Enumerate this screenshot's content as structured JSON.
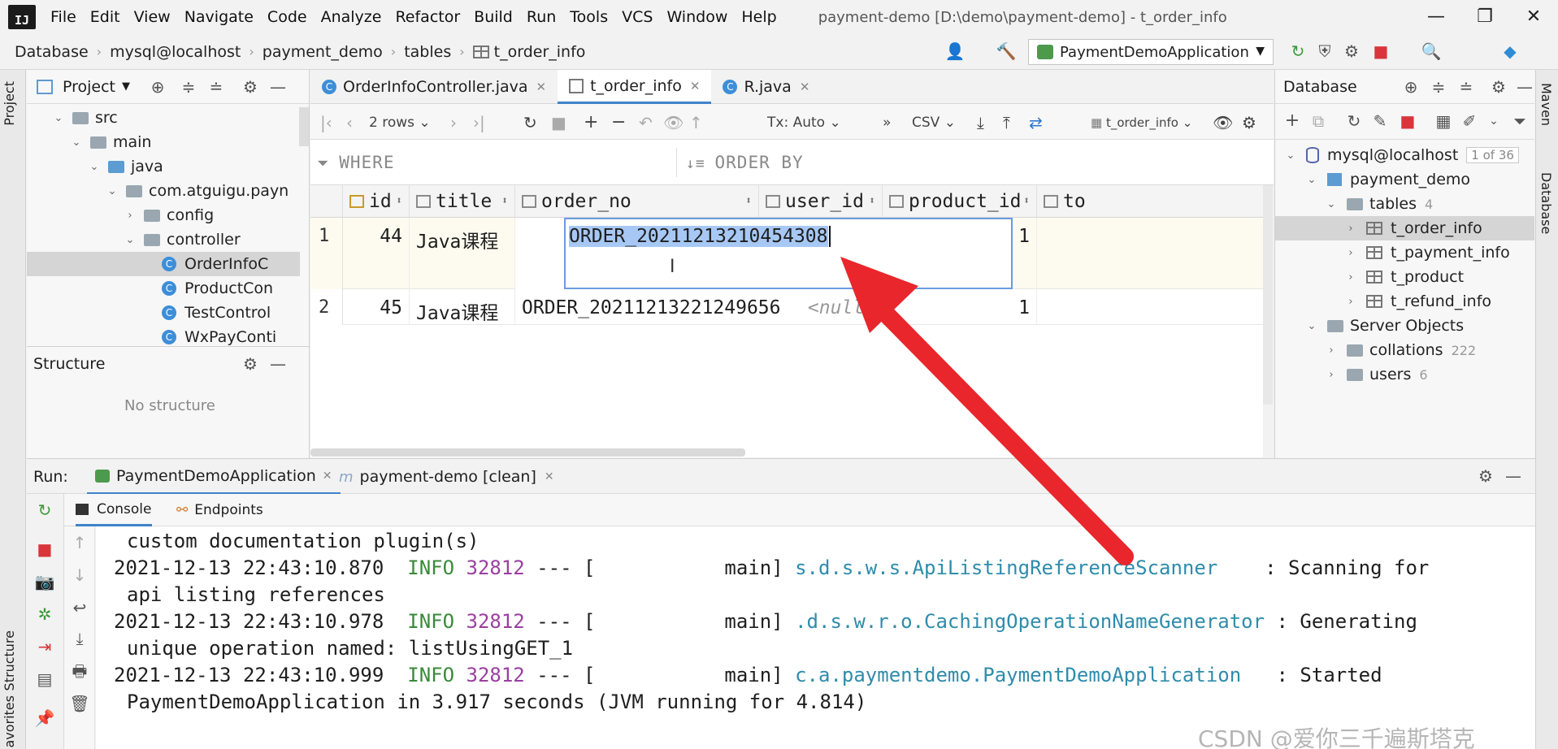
{
  "window": {
    "logo": "IJ",
    "title": "payment-demo [D:\\demo\\payment-demo] - t_order_info",
    "controls": [
      "—",
      "❐",
      "✕"
    ]
  },
  "menu": [
    "File",
    "Edit",
    "View",
    "Navigate",
    "Code",
    "Analyze",
    "Refactor",
    "Build",
    "Run",
    "Tools",
    "VCS",
    "Window",
    "Help"
  ],
  "breadcrumb": [
    "Database",
    "mysql@localhost",
    "payment_demo",
    "tables",
    "t_order_info"
  ],
  "run_config": "PaymentDemoApplication",
  "project_panel": {
    "title": "Project",
    "tree": [
      {
        "label": "src",
        "depth": 0,
        "kind": "folder",
        "expanded": true
      },
      {
        "label": "main",
        "depth": 1,
        "kind": "folder",
        "expanded": true
      },
      {
        "label": "java",
        "depth": 2,
        "kind": "folder-blue",
        "expanded": true
      },
      {
        "label": "com.atguigu.payn",
        "depth": 3,
        "kind": "package",
        "expanded": true
      },
      {
        "label": "config",
        "depth": 4,
        "kind": "folder",
        "expanded": false
      },
      {
        "label": "controller",
        "depth": 4,
        "kind": "folder",
        "expanded": true
      },
      {
        "label": "OrderInfoC",
        "depth": 5,
        "kind": "class",
        "selected": true
      },
      {
        "label": "ProductCon",
        "depth": 5,
        "kind": "class"
      },
      {
        "label": "TestControl",
        "depth": 5,
        "kind": "class"
      },
      {
        "label": "WxPayConti",
        "depth": 5,
        "kind": "class"
      }
    ]
  },
  "structure_panel": {
    "title": "Structure",
    "empty_text": "No structure"
  },
  "left_strip": {
    "project": "Project",
    "structure": "Structure",
    "favorites": "avorites"
  },
  "right_strip": {
    "maven": "Maven",
    "database": "Database"
  },
  "editor_tabs": [
    {
      "label": "OrderInfoController.java",
      "icon": "C",
      "active": false
    },
    {
      "label": "t_order_info",
      "icon": "table",
      "active": true
    },
    {
      "label": "R.java",
      "icon": "C",
      "active": false
    }
  ],
  "grid_toolbar": {
    "rows": "2 rows",
    "tx": "Tx: Auto",
    "export": "CSV",
    "table_selector": "t_order_info"
  },
  "filter": {
    "where": "WHERE",
    "order_by": "ORDER BY"
  },
  "grid": {
    "columns": [
      "id",
      "title",
      "order_no",
      "user_id",
      "product_id",
      "to"
    ],
    "rows": [
      {
        "num": "1",
        "id": "44",
        "title": "Java课程",
        "order_no": "ORDER_20211213210454308",
        "user_id": "",
        "product_id": "1"
      },
      {
        "num": "2",
        "id": "45",
        "title": "Java课程",
        "order_no": "ORDER_20211213221249656",
        "user_id": "<null>",
        "product_id": "1"
      }
    ]
  },
  "database_panel": {
    "title": "Database",
    "connection": "mysql@localhost",
    "connection_badge": "1 of 36",
    "schema": "payment_demo",
    "tables_label": "tables",
    "tables_count": "4",
    "tables": [
      "t_order_info",
      "t_payment_info",
      "t_product",
      "t_refund_info"
    ],
    "server_objects": "Server Objects",
    "collations": "collations",
    "collations_count": "222",
    "users": "users",
    "users_count": "6"
  },
  "run_panel": {
    "label": "Run:",
    "tabs": [
      "PaymentDemoApplication",
      "payment-demo [clean]"
    ],
    "subtabs": [
      "Console",
      "Endpoints"
    ]
  },
  "console": {
    "lines": [
      {
        "kind": "cont",
        "text": "custom documentation plugin(s)"
      },
      {
        "kind": "log",
        "ts": "2021-12-13 22:43:10.870",
        "level": "INFO",
        "pid": "32812",
        "thread": "--- [           main]",
        "logger": "s.d.s.w.s.ApiListingReferenceScanner",
        "msg": "    : Scanning for"
      },
      {
        "kind": "cont",
        "text": "api listing references"
      },
      {
        "kind": "log",
        "ts": "2021-12-13 22:43:10.978",
        "level": "INFO",
        "pid": "32812",
        "thread": "--- [           main]",
        "logger": ".d.s.w.r.o.CachingOperationNameGenerator",
        "msg": " : Generating"
      },
      {
        "kind": "cont",
        "text": "unique operation named: listUsingGET_1"
      },
      {
        "kind": "log",
        "ts": "2021-12-13 22:43:10.999",
        "level": "INFO",
        "pid": "32812",
        "thread": "--- [           main]",
        "logger": "c.a.paymentdemo.PaymentDemoApplication",
        "msg": "   : Started"
      },
      {
        "kind": "cont",
        "text": "PaymentDemoApplication in 3.917 seconds (JVM running for 4.814)"
      }
    ]
  },
  "watermark": "CSDN @爱你三千遍斯塔克",
  "colors": {
    "accent": "#4083c9",
    "selection": "#a7c8f4",
    "annotation_arrow": "#e8262b",
    "log_info": "#3a8a3a",
    "log_pid": "#9a3fa0",
    "log_logger": "#2f8cab"
  }
}
